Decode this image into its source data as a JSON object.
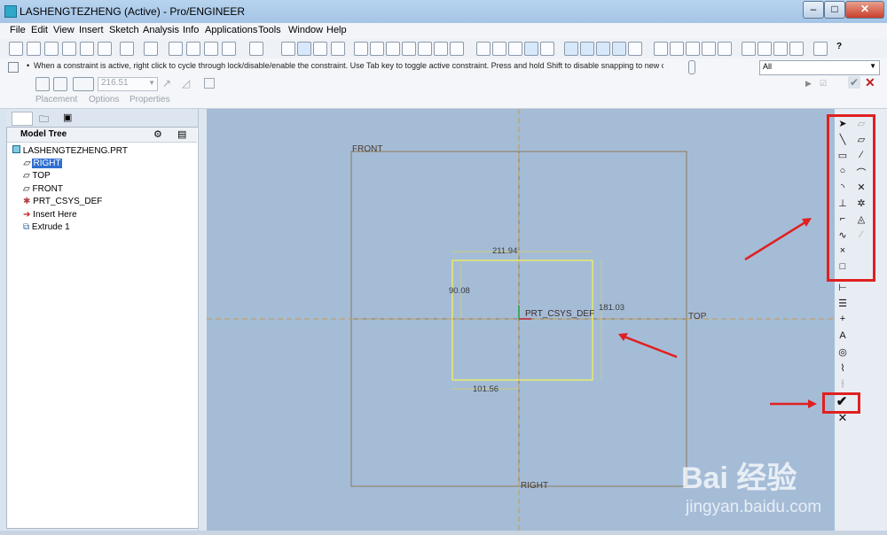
{
  "window": {
    "title": "LASHENGTEZHENG (Active) - Pro/ENGINEER"
  },
  "menu": [
    "File",
    "Edit",
    "View",
    "Insert",
    "Sketch",
    "Analysis",
    "Info",
    "Applications",
    "Tools",
    "Window",
    "Help"
  ],
  "message": "When a constraint is active, right click to cycle through lock/disable/enable the constraint. Use Tab key to toggle active constraint. Press and hold Shift to disable snapping to new constra",
  "filter": {
    "value": "All"
  },
  "dashboard": {
    "depth_value": "216.51",
    "tabs": [
      "Placement",
      "Options",
      "Properties"
    ]
  },
  "model_tree": {
    "title": "Model Tree",
    "items": [
      {
        "label": "LASHENGTEZHENG.PRT",
        "icon": "part-icon"
      },
      {
        "label": "RIGHT",
        "icon": "datum-plane-icon"
      },
      {
        "label": "TOP",
        "icon": "datum-plane-icon"
      },
      {
        "label": "FRONT",
        "icon": "datum-plane-icon"
      },
      {
        "label": "PRT_CSYS_DEF",
        "icon": "csys-icon"
      },
      {
        "label": "Insert Here",
        "icon": "insert-arrow-icon"
      },
      {
        "label": "Extrude 1",
        "icon": "extrude-icon"
      }
    ]
  },
  "sketch": {
    "plane_labels": {
      "front": "FRONT",
      "top": "TOP",
      "right": "RIGHT",
      "csys": "PRT_CSYS_DEF"
    },
    "dimensions": {
      "width": "211.94",
      "height": "181.03",
      "left_height": "90.08",
      "bottom_offset": "101.56"
    }
  },
  "watermark": {
    "brand": "Bai 经验",
    "url": "jingyan.baidu.com"
  },
  "colors": {
    "graphics_bg": "#a5bcd7",
    "sketch_line": "#f2f05a",
    "plane_line": "#8a7a5a",
    "highlight": "#e00000",
    "annotation_arrow": "#e02020"
  }
}
